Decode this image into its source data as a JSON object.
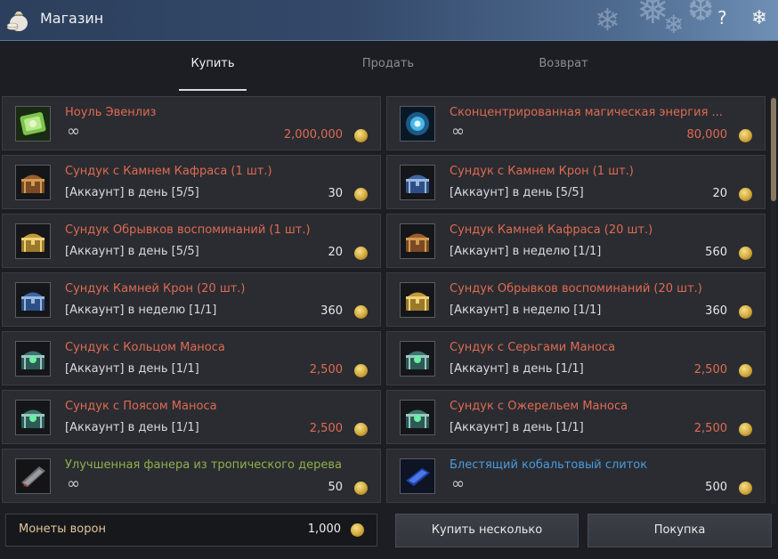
{
  "window": {
    "title": "Магазин"
  },
  "tabs": [
    {
      "label": "Купить",
      "active": true
    },
    {
      "label": "Продать",
      "active": false
    },
    {
      "label": "Возврат",
      "active": false
    }
  ],
  "items": [
    {
      "name": "Ноуль Эвенлиз",
      "limit": "∞",
      "price": "2,000,000",
      "name_color": "#e06a52",
      "price_color": "#e06a52",
      "icon": "green-scroll-icon"
    },
    {
      "name": "Сконцентрированная магическая энергия ...",
      "limit": "∞",
      "price": "80,000",
      "name_color": "#e06a52",
      "price_color": "#e06a52",
      "icon": "blue-energy-orb-icon"
    },
    {
      "name": "Сундук с Камнем Кафраса (1 шт.)",
      "limit": "[Аккаунт] в день [5/5]",
      "price": "30",
      "name_color": "#e06a52",
      "price_color": "#e8e8e8",
      "icon": "brown-chest-icon"
    },
    {
      "name": "Сундук с Камнем Крон (1 шт.)",
      "limit": "[Аккаунт] в день [5/5]",
      "price": "20",
      "name_color": "#e06a52",
      "price_color": "#e8e8e8",
      "icon": "blue-chest-icon"
    },
    {
      "name": "Сундук Обрывков воспоминаний (1 шт.)",
      "limit": "[Аккаунт] в день [5/5]",
      "price": "20",
      "name_color": "#e06a52",
      "price_color": "#e8e8e8",
      "icon": "gold-chest-icon"
    },
    {
      "name": "Сундук Камней Кафраса (20 шт.)",
      "limit": "[Аккаунт] в неделю [1/1]",
      "price": "560",
      "name_color": "#e06a52",
      "price_color": "#e8e8e8",
      "icon": "brown-chest-icon"
    },
    {
      "name": "Сундук Камней Крон (20 шт.)",
      "limit": "[Аккаунт] в неделю [1/1]",
      "price": "360",
      "name_color": "#e06a52",
      "price_color": "#e8e8e8",
      "icon": "blue-chest-icon"
    },
    {
      "name": "Сундук Обрывков воспоминаний (20 шт.)",
      "limit": "[Аккаунт] в неделю [1/1]",
      "price": "360",
      "name_color": "#e06a52",
      "price_color": "#e8e8e8",
      "icon": "gold-chest-icon"
    },
    {
      "name": "Сундук с Кольцом Маноса",
      "limit": "[Аккаунт] в день [1/1]",
      "price": "2,500",
      "name_color": "#e06a52",
      "price_color": "#e06a52",
      "icon": "teal-chest-icon"
    },
    {
      "name": "Сундук с Серьгами Маноса",
      "limit": "[Аккаунт] в день [1/1]",
      "price": "2,500",
      "name_color": "#e06a52",
      "price_color": "#e06a52",
      "icon": "teal-chest-icon"
    },
    {
      "name": "Сундук с Поясом Маноса",
      "limit": "[Аккаунт] в день [1/1]",
      "price": "2,500",
      "name_color": "#e06a52",
      "price_color": "#e06a52",
      "icon": "teal-chest-icon"
    },
    {
      "name": "Сундук с Ожерельем Маноса",
      "limit": "[Аккаунт] в день [1/1]",
      "price": "2,500",
      "name_color": "#e06a52",
      "price_color": "#e06a52",
      "icon": "teal-chest-icon"
    },
    {
      "name": "Улучшенная фанера из тропического дерева",
      "limit": "∞",
      "price": "50",
      "name_color": "#8fb04c",
      "price_color": "#e8e8e8",
      "icon": "plywood-icon"
    },
    {
      "name": "Блестящий кобальтовый слиток",
      "limit": "∞",
      "price": "500",
      "name_color": "#4a9be0",
      "price_color": "#e8e8e8",
      "icon": "cobalt-ingot-icon"
    }
  ],
  "currency": {
    "label": "Монеты ворон",
    "value": "1,000",
    "icon": "crow-coin-icon"
  },
  "buttons": {
    "buy_multiple": "Купить несколько",
    "purchase": "Покупка"
  },
  "icons": {
    "window": "money-bag-icon",
    "help": "?",
    "close": "snowflake-close-icon",
    "coin": "crow-coin-icon"
  }
}
